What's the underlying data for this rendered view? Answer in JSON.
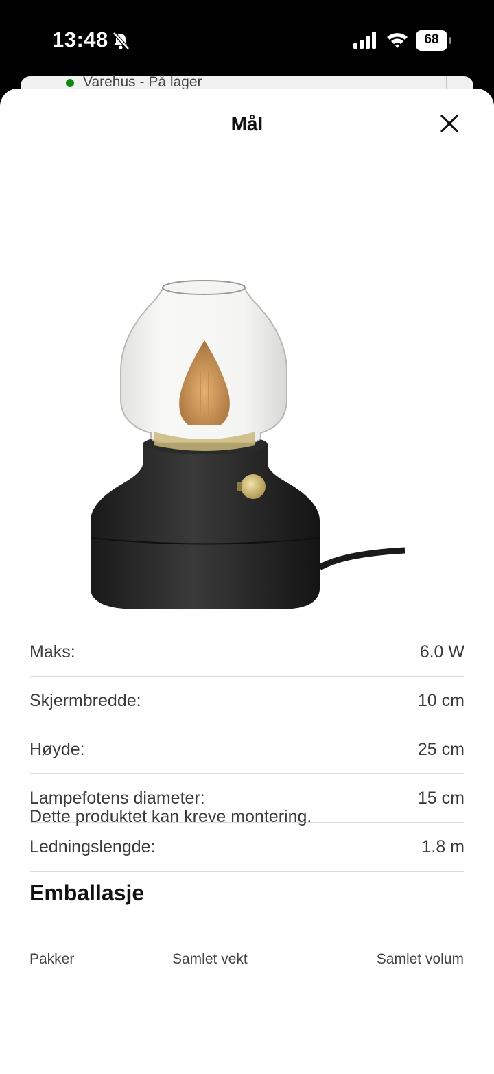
{
  "status_bar": {
    "time": "13:48",
    "battery": "68",
    "icons": [
      "bell-slash-icon",
      "signal-icon",
      "wifi-icon",
      "battery-icon"
    ]
  },
  "background_card": {
    "stock_text": "Varehus - På lager",
    "stock_color": "#0a8a0a"
  },
  "sheet": {
    "title": "Mål",
    "close_icon": "close-icon",
    "image_alt": "table lamp with glass shade and black base"
  },
  "specs": [
    {
      "label": "Maks:",
      "value": "6.0 W"
    },
    {
      "label": "Skjermbredde:",
      "value": "10 cm"
    },
    {
      "label": "Høyde:",
      "value": "25 cm"
    },
    {
      "label": "Lampefotens diameter:",
      "value": "15 cm"
    },
    {
      "label": "Ledningslengde:",
      "value": "1.8 m"
    }
  ],
  "assembly_note": "Dette produktet kan kreve montering.",
  "packaging": {
    "heading": "Emballasje",
    "columns": [
      {
        "label": "Pakker"
      },
      {
        "label": "Samlet vekt"
      },
      {
        "label": "Samlet volum"
      }
    ]
  }
}
